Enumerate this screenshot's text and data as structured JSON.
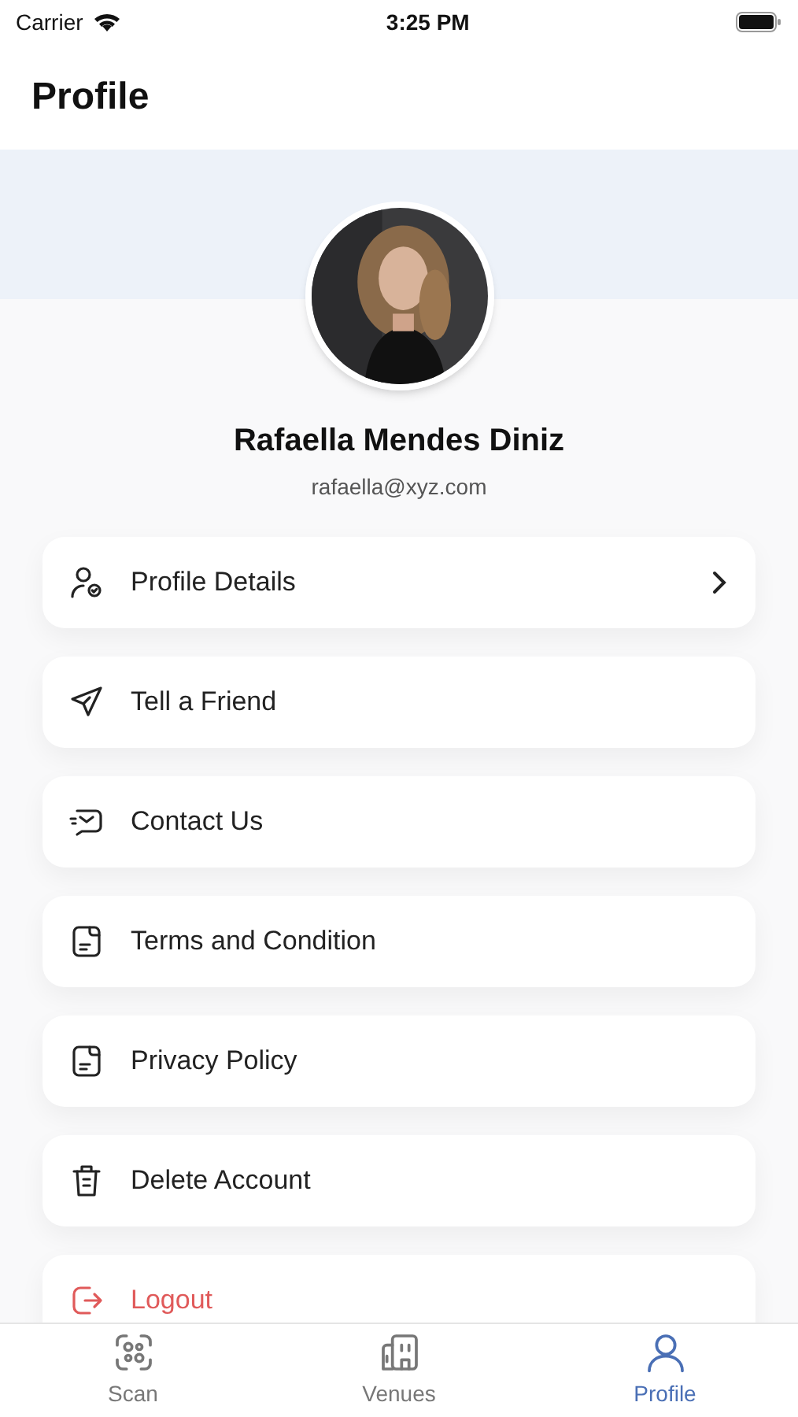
{
  "status_bar": {
    "carrier": "Carrier",
    "time": "3:25 PM"
  },
  "header": {
    "title": "Profile"
  },
  "profile": {
    "name": "Rafaella Mendes Diniz",
    "email": "rafaella@xyz.com"
  },
  "menu": [
    {
      "label": "Profile Details",
      "kind": "normal",
      "chevron": true
    },
    {
      "label": "Tell a Friend",
      "kind": "normal",
      "chevron": false
    },
    {
      "label": "Contact Us",
      "kind": "normal",
      "chevron": false
    },
    {
      "label": "Terms and Condition",
      "kind": "normal",
      "chevron": false
    },
    {
      "label": "Privacy Policy",
      "kind": "normal",
      "chevron": false
    },
    {
      "label": "Delete Account",
      "kind": "normal",
      "chevron": false
    },
    {
      "label": "Logout",
      "kind": "danger",
      "chevron": false
    }
  ],
  "tab_bar": [
    {
      "label": "Scan",
      "selected": false
    },
    {
      "label": "Venues",
      "selected": false
    },
    {
      "label": "Profile",
      "selected": true
    }
  ]
}
